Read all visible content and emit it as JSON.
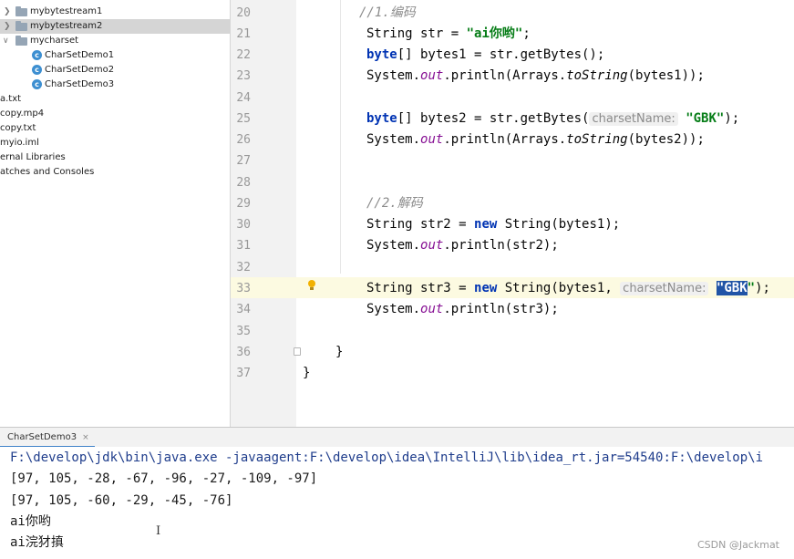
{
  "project_tree": {
    "items": [
      {
        "label": "mybytestream1"
      },
      {
        "label": "mybytestream2"
      },
      {
        "label": "mycharset"
      },
      {
        "label": "CharSetDemo1"
      },
      {
        "label": "CharSetDemo2"
      },
      {
        "label": "CharSetDemo3"
      },
      {
        "label": "a.txt"
      },
      {
        "label": "copy.mp4"
      },
      {
        "label": "copy.txt"
      },
      {
        "label": "myio.iml"
      },
      {
        "label": "ernal Libraries"
      },
      {
        "label": "atches and Consoles"
      }
    ]
  },
  "editor": {
    "line_numbers": [
      "20",
      "21",
      "22",
      "23",
      "24",
      "25",
      "26",
      "27",
      "28",
      "29",
      "30",
      "31",
      "32",
      "33",
      "34",
      "35",
      "36",
      "37"
    ],
    "line20": {
      "comment": "//1.编码"
    },
    "line21": {
      "type": "String",
      "rest": " str = ",
      "str": "\"ai你哟\"",
      "end": ";"
    },
    "line22": {
      "kw": "byte",
      "rest": "[] bytes1 = str.getBytes();"
    },
    "line23": {
      "a": "System.",
      "field": "out",
      "b": ".println(Arrays.",
      "static": "toString",
      "c": "(bytes1));"
    },
    "line25": {
      "kw": "byte",
      "rest": "[] bytes2 = str.getBytes(",
      "hint": "charsetName:",
      "str": "\"GBK\"",
      "end": ");"
    },
    "line26": {
      "a": "System.",
      "field": "out",
      "b": ".println(Arrays.",
      "static": "toString",
      "c": "(bytes2));"
    },
    "line29": {
      "comment": "//2.解码"
    },
    "line30": {
      "a": "String str2 = ",
      "kw": "new",
      "b": " String(bytes1);"
    },
    "line31": {
      "a": "System.",
      "field": "out",
      "b": ".println(str2);"
    },
    "line33": {
      "a": "String str3 = ",
      "kw": "new",
      "b": " String(bytes1, ",
      "hint": "charsetName:",
      "sel": "\"GBK",
      "sel_rest": "\"",
      "end": ");"
    },
    "line34": {
      "a": "System.",
      "field": "out",
      "b": ".println(str3);"
    },
    "line36": {
      "brace": "}"
    },
    "line37": {
      "brace": "}"
    }
  },
  "run_panel": {
    "tab_label": "CharSetDemo3",
    "close_icon": "×",
    "lines": [
      "F:\\develop\\jdk\\bin\\java.exe -javaagent:F:\\develop\\idea\\IntelliJ\\lib\\idea_rt.jar=54540:F:\\develop\\i",
      "[97, 105, -28, -67, -96, -27, -109, -97]",
      "[97, 105, -60, -29, -45, -76]",
      "ai你哟",
      "ai浣犲搷"
    ]
  },
  "watermark": "CSDN @Jackmat",
  "colors": {
    "keyword": "#0033b3",
    "string": "#067d17",
    "comment": "#8c8c8c",
    "field": "#871094",
    "selection": "#2154a6",
    "caret_line": "#fcfae1"
  }
}
